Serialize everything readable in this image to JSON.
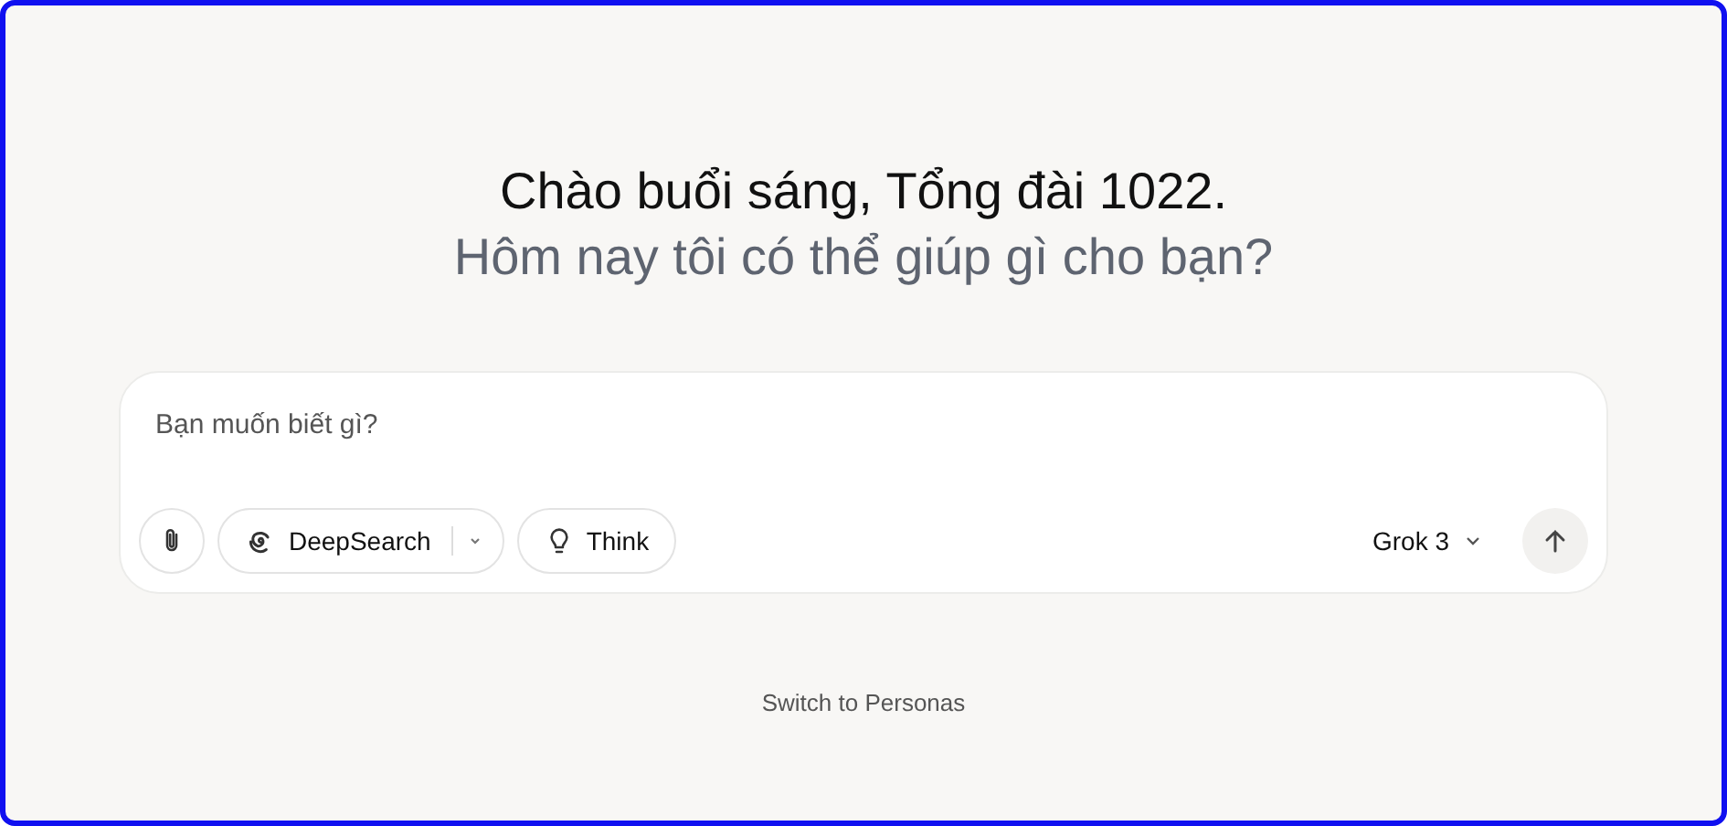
{
  "greeting": {
    "title": "Chào buổi sáng, Tổng đài 1022.",
    "subtitle": "Hôm nay tôi có thể giúp gì cho bạn?"
  },
  "composer": {
    "placeholder": "Bạn muốn biết gì?",
    "tools": [
      {
        "kind": "split",
        "label": "DeepSearch"
      },
      {
        "kind": "plain",
        "label": "Think"
      }
    ],
    "model": "Grok 3"
  },
  "footer_link": "Switch to Personas"
}
